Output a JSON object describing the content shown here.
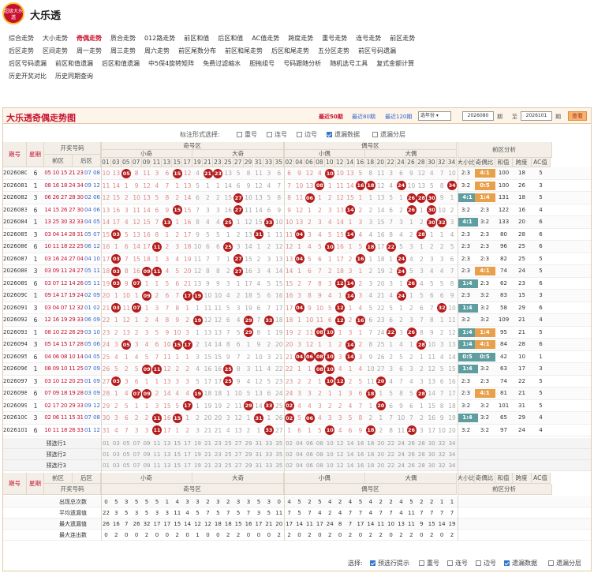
{
  "header": {
    "logo_text": "超级大乐透",
    "title": "大乐透"
  },
  "nav": [
    [
      "综合走势",
      "大小走势",
      "奇偶走势",
      "质合走势",
      "012路走势",
      "前区和值",
      "后区和值",
      "AC值走势",
      "跨度走势",
      "重号走势",
      "连号走势",
      "前区走势"
    ],
    [
      "后区走势",
      "区间走势",
      "周一走势",
      "周三走势",
      "周六走势",
      "前区尾数分布",
      "前区和尾走势",
      "后区和尾走势",
      "五分区走势",
      "前区号码遗漏"
    ],
    [
      "后区号码遗漏",
      "前区和值遗漏",
      "后区和值遗漏",
      "中5保4旋转矩阵",
      "免费过滤缩水",
      "胆拖组号",
      "号码跟随分析",
      "随机选号工具",
      "复式金额计算"
    ],
    [
      "历史开奖对比",
      "历史同期查询"
    ]
  ],
  "nav_active": "奇偶走势",
  "panel": {
    "title": "大乐透奇偶走势图",
    "periods": [
      "最近50期",
      "最近80期",
      "最近120期"
    ],
    "select": "选年份",
    "from": "2026080",
    "to": "2026101",
    "period_unit": "期",
    "to_label": "至",
    "query": "查看"
  },
  "options": {
    "label": "标注形式选择:",
    "items": [
      {
        "t": "重号",
        "on": false
      },
      {
        "t": "连号",
        "on": false
      },
      {
        "t": "边号",
        "on": false
      },
      {
        "t": "遗漏数据",
        "on": true
      },
      {
        "t": "遗漏分层",
        "on": false
      }
    ]
  },
  "headers": {
    "period": "期号",
    "week": "星期",
    "draw": "开奖号码",
    "front": "前区",
    "back": "后区",
    "odd": "奇号区",
    "small_odd": "小奇",
    "big_odd": "大奇",
    "even": "偶号区",
    "small_even": "小偶",
    "big_even": "大偶",
    "analysis": "前区分析",
    "a_cols": [
      "大小比",
      "奇偶比",
      "和值",
      "跨度",
      "AC值"
    ]
  },
  "odd_nums": [
    "01",
    "03",
    "05",
    "07",
    "09",
    "11",
    "13",
    "15",
    "17",
    "19",
    "21",
    "23",
    "25",
    "27",
    "29",
    "31",
    "33",
    "35"
  ],
  "even_nums": [
    "02",
    "04",
    "06",
    "08",
    "10",
    "12",
    "14",
    "16",
    "18",
    "20",
    "22",
    "24",
    "26",
    "28",
    "30",
    "32",
    "34"
  ],
  "rows": [
    {
      "p": "2026080",
      "w": "6",
      "f": "05 10 15 21 23",
      "b": "07 08",
      "ds": "2:3",
      "ob": "4:1",
      "s": "100",
      "sp": "18",
      "ac": "5",
      "ot": "o"
    },
    {
      "p": "2026081",
      "w": "1",
      "f": "08 16 18 24 34",
      "b": "09 12",
      "ds": "3:2",
      "ob": "0:5",
      "s": "100",
      "sp": "26",
      "ac": "3",
      "ot": "o"
    },
    {
      "p": "2026082",
      "w": "3",
      "f": "06 26 27 28 30",
      "b": "02 06",
      "ds": "4:1",
      "ob": "1:4",
      "s": "131",
      "sp": "18",
      "ac": "5",
      "ot": "o",
      "dg": 1
    },
    {
      "p": "2026083",
      "w": "6",
      "f": "14 15 26 27 30",
      "b": "04 06",
      "ds": "3:2",
      "ob": "2:3",
      "s": "122",
      "sp": "16",
      "ac": "4"
    },
    {
      "p": "2026084",
      "w": "1",
      "f": "13 25 30 32 33",
      "b": "04 05",
      "ds": "4:1",
      "ob": "3:2",
      "s": "133",
      "sp": "20",
      "ac": "6",
      "dg": 1
    },
    {
      "p": "2026085",
      "w": "3",
      "f": "03 04 14 28 31",
      "b": "05 07",
      "ds": "2:3",
      "ob": "2:3",
      "s": "80",
      "sp": "28",
      "ac": "6"
    },
    {
      "p": "2026086",
      "w": "6",
      "f": "10 11 18 22 25",
      "b": "06 12",
      "ds": "2:3",
      "ob": "2:3",
      "s": "96",
      "sp": "25",
      "ac": "6"
    },
    {
      "p": "2026087",
      "w": "1",
      "f": "03 16 24 27 04",
      "b": "04 10",
      "ds": "2:3",
      "ob": "2:3",
      "s": "82",
      "sp": "25",
      "ac": "5"
    },
    {
      "p": "2026088",
      "w": "3",
      "f": "03 09 11 24 27",
      "b": "05 11",
      "ds": "2:3",
      "ob": "4:1",
      "s": "74",
      "sp": "24",
      "ac": "5",
      "ot": "o"
    },
    {
      "p": "2026089",
      "w": "6",
      "f": "03 07 12 14 26",
      "b": "05 11",
      "ds": "1:4",
      "ob": "2:3",
      "s": "62",
      "sp": "23",
      "ac": "6",
      "dg": 1
    },
    {
      "p": "2026090",
      "w": "1",
      "f": "09 14 17 19 24",
      "b": "02 09",
      "ds": "2:3",
      "ob": "3:2",
      "s": "83",
      "sp": "15",
      "ac": "3"
    },
    {
      "p": "2026091",
      "w": "3",
      "f": "03 04 07 12 32",
      "b": "01 02",
      "ds": "1:4",
      "ob": "3:2",
      "s": "58",
      "sp": "29",
      "ac": "6",
      "dg": 1
    },
    {
      "p": "2026092",
      "w": "6",
      "f": "12 16 19 29 33",
      "b": "06 09",
      "ds": "3:2",
      "ob": "3:2",
      "s": "109",
      "sp": "21",
      "ac": "4"
    },
    {
      "p": "2026093",
      "w": "1",
      "f": "08 10 22 26 29",
      "b": "03 10",
      "ds": "1:4",
      "ob": "1:4",
      "s": "95",
      "sp": "21",
      "ac": "5",
      "dg": 1,
      "ot": "o"
    },
    {
      "p": "2026094",
      "w": "3",
      "f": "05 14 15 17 28",
      "b": "05 06",
      "ds": "1:4",
      "ob": "4:1",
      "s": "84",
      "sp": "28",
      "ac": "6",
      "dg": 1,
      "ot": "o"
    },
    {
      "p": "2026095",
      "w": "6",
      "f": "04 06 08 10 14",
      "b": "04 05",
      "ds": "0:5",
      "ob": "0:5",
      "s": "42",
      "sp": "10",
      "ac": "1",
      "dg": 1,
      "ot": "g"
    },
    {
      "p": "2026096",
      "w": "1",
      "f": "08 09 10 11 25",
      "b": "07 09",
      "ds": "1:4",
      "ob": "3:2",
      "s": "63",
      "sp": "17",
      "ac": "3",
      "dg": 1
    },
    {
      "p": "2026097",
      "w": "3",
      "f": "03 10 12 20 25",
      "b": "01 09",
      "ds": "2:3",
      "ob": "2:3",
      "s": "74",
      "sp": "22",
      "ac": "5"
    },
    {
      "p": "2026098",
      "w": "6",
      "f": "07 09 18 19 28",
      "b": "03 09",
      "ds": "2:3",
      "ob": "4:1",
      "s": "81",
      "sp": "21",
      "ac": "5",
      "ot": "o"
    },
    {
      "p": "2026099",
      "w": "1",
      "f": "02 17 20 29 33",
      "b": "09 12",
      "ds": "3:2",
      "ob": "3:2",
      "s": "101",
      "sp": "31",
      "ac": "5"
    },
    {
      "p": "2026100",
      "w": "3",
      "f": "02 06 11 15 31",
      "b": "07 08",
      "ds": "1:4",
      "ob": "3:2",
      "s": "65",
      "sp": "29",
      "ac": "4",
      "dg": 1
    },
    {
      "p": "2026101",
      "w": "6",
      "f": "10 11 18 26 33",
      "b": "01 12",
      "ds": "3:2",
      "ob": "3:2",
      "s": "97",
      "sp": "24",
      "ac": "4"
    }
  ],
  "predict": [
    "预选行1",
    "预选行2",
    "预选行3"
  ],
  "stats": [
    {
      "label": "出现总次数",
      "odd": [
        "0",
        "5",
        "3",
        "5",
        "5",
        "5",
        "1",
        "4",
        "3",
        "3",
        "2",
        "3",
        "2",
        "3",
        "3",
        "5",
        "3",
        "0"
      ],
      "even": [
        "4",
        "5",
        "2",
        "5",
        "4",
        "2",
        "4",
        "5",
        "4",
        "2",
        "2",
        "4",
        "5",
        "2",
        "2",
        "1",
        "1"
      ]
    },
    {
      "label": "平均遗漏值",
      "odd": [
        "22",
        "3",
        "5",
        "3",
        "5",
        "3",
        "3",
        "11",
        "4",
        "5",
        "7",
        "5",
        "7",
        "5",
        "7",
        "3",
        "5",
        "11"
      ],
      "even": [
        "7",
        "5",
        "7",
        "4",
        "2",
        "4",
        "7",
        "7",
        "4",
        "7",
        "7",
        "4",
        "11",
        "7",
        "7",
        "7",
        "7"
      ]
    },
    {
      "label": "最大遗漏值",
      "odd": [
        "26",
        "16",
        "7",
        "26",
        "32",
        "17",
        "17",
        "15",
        "14",
        "12",
        "12",
        "18",
        "18",
        "15",
        "16",
        "17",
        "21",
        "20"
      ],
      "even": [
        "17",
        "14",
        "11",
        "17",
        "24",
        "8",
        "7",
        "17",
        "14",
        "11",
        "10",
        "13",
        "11",
        "9",
        "15",
        "14",
        "19"
      ]
    },
    {
      "label": "最大连出数",
      "odd": [
        "0",
        "2",
        "0",
        "0",
        "2",
        "0",
        "0",
        "2",
        "0",
        "1",
        "0",
        "0",
        "2",
        "2",
        "0",
        "0",
        "0",
        "2"
      ],
      "even": [
        "2",
        "0",
        "2",
        "0",
        "2",
        "0",
        "2",
        "0",
        "2",
        "2",
        "0",
        "2",
        "2",
        "0",
        "2",
        "0",
        "2"
      ]
    }
  ],
  "bottom": {
    "label": "选择:",
    "items": [
      {
        "t": "预选行提示",
        "on": true
      },
      {
        "t": "重号",
        "on": false
      },
      {
        "t": "连号",
        "on": false
      },
      {
        "t": "边号",
        "on": false
      },
      {
        "t": "遗漏数据",
        "on": true
      },
      {
        "t": "遗漏分层",
        "on": false
      }
    ]
  }
}
